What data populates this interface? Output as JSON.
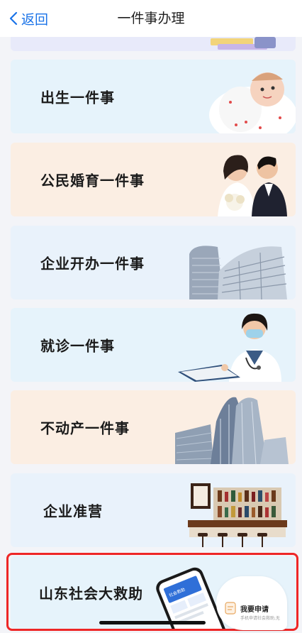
{
  "nav": {
    "back_label": "返回",
    "title": "一件事办理"
  },
  "cards": [
    {
      "label": "出生一件事",
      "icon": "baby-icon"
    },
    {
      "label": "公民婚育一件事",
      "icon": "couple-icon"
    },
    {
      "label": "企业开办一件事",
      "icon": "buildings-icon"
    },
    {
      "label": "就诊一件事",
      "icon": "doctor-icon"
    },
    {
      "label": "不动产一件事",
      "icon": "skyscraper-icon"
    },
    {
      "label": "企业准营",
      "icon": "bar-counter-icon"
    },
    {
      "label": "山东社会大救助",
      "icon": "phone-icon"
    }
  ],
  "apply_popup": {
    "title": "我要申请",
    "subtitle": "手机申请社会救助,无"
  },
  "colors": {
    "accent": "#1a73e8",
    "highlight": "#ee2626",
    "card_blue": "#e6f3fb",
    "card_peach": "#fbeee3"
  }
}
